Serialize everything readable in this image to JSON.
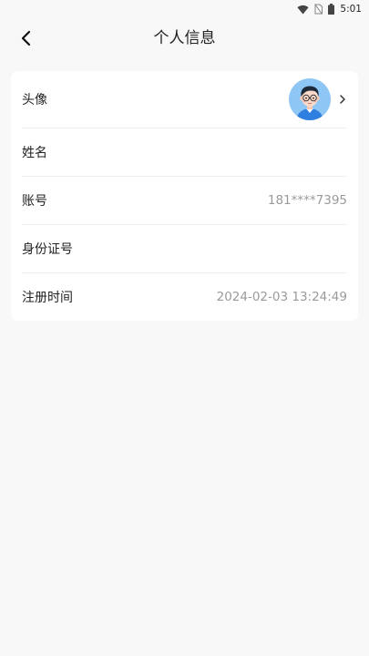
{
  "status_bar": {
    "time": "5:01",
    "icons": [
      "wifi-icon",
      "no-sim-icon",
      "battery-icon"
    ]
  },
  "header": {
    "title": "个人信息",
    "back_icon": "chevron-left-icon"
  },
  "profile": {
    "rows": [
      {
        "label": "头像",
        "value": "",
        "type": "avatar"
      },
      {
        "label": "姓名",
        "value": ""
      },
      {
        "label": "账号",
        "value": "181****7395"
      },
      {
        "label": "身份证号",
        "value": ""
      },
      {
        "label": "注册时间",
        "value": "2024-02-03 13:24:49"
      }
    ]
  },
  "colors": {
    "background": "#f8f8f8",
    "card": "#ffffff",
    "muted_text": "#9a9a9a",
    "avatar_bg": "#8ec6f5"
  }
}
